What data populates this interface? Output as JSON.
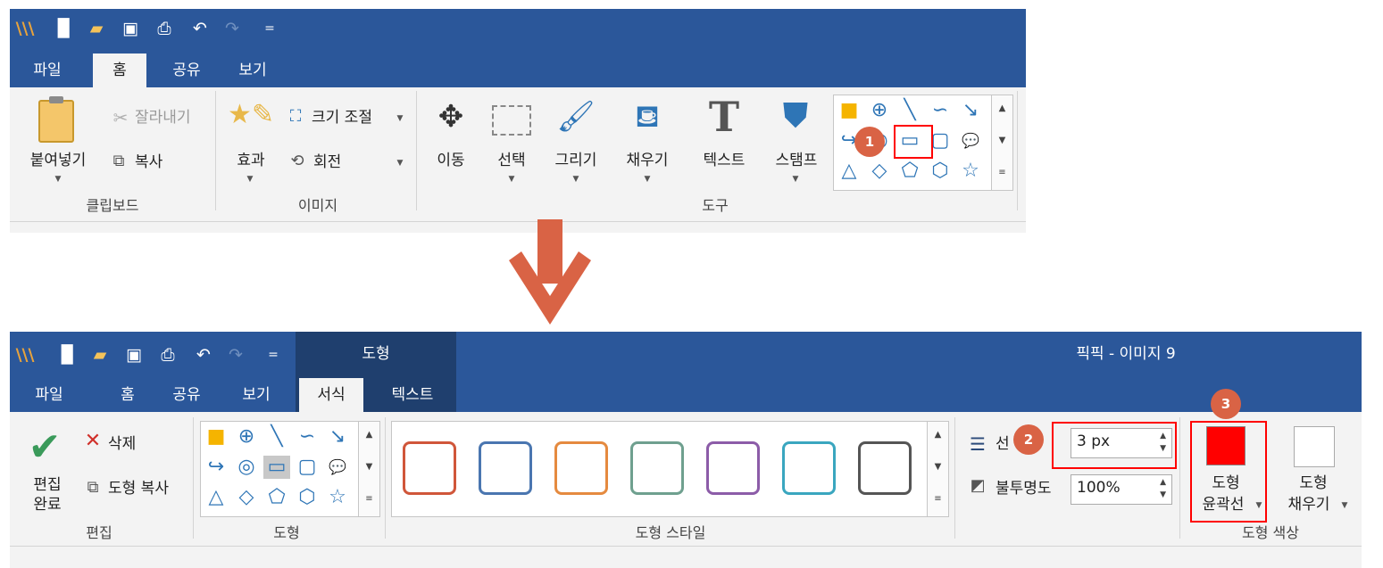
{
  "top": {
    "quick_access": {
      "icons": [
        "app-logo-icon",
        "new-file-icon",
        "open-folder-icon",
        "save-icon",
        "print-icon",
        "undo-icon",
        "redo-icon",
        "customize-icon"
      ],
      "customize_symbol": "="
    },
    "tabs": [
      "파일",
      "홈",
      "공유",
      "보기"
    ],
    "active_tab": "홈",
    "clipboard": {
      "paste": "붙여넣기",
      "cut": "잘라내기",
      "copy": "복사",
      "group": "클립보드"
    },
    "image": {
      "effect": "효과",
      "resize": "크기 조절",
      "rotate": "회전",
      "group": "이미지"
    },
    "tools": {
      "move": "이동",
      "select": "선택",
      "draw": "그리기",
      "fill": "채우기",
      "text": "텍스트",
      "stamp": "스탬프",
      "group": "도구"
    },
    "shape_gallery": [
      "■",
      "⊕",
      "╲",
      "∽",
      "↘",
      "↪",
      "◎",
      "▭",
      "▢",
      "💬",
      "△",
      "◇",
      "⬠",
      "⬡",
      "☆"
    ],
    "badge": "1"
  },
  "bottom": {
    "context_tab": "도형",
    "window_title": "픽픽 - 이미지 9",
    "tabs": [
      "파일",
      "홈",
      "공유",
      "보기",
      "서식",
      "텍스트"
    ],
    "active_tab": "서식",
    "edit": {
      "done_line1": "편집",
      "done_line2": "완료",
      "delete": "삭제",
      "copy_shape": "도형 복사",
      "group": "편집"
    },
    "shapes_group": "도형",
    "shape_styles_group": "도형 스타일",
    "style_colors": [
      "#d0563a",
      "#4a76b0",
      "#e58a3f",
      "#6fa08f",
      "#8c5ca8",
      "#3aa6bf",
      "#555555"
    ],
    "line_thickness": {
      "label_visible": "선",
      "value": "3 px"
    },
    "opacity": {
      "label": "불투명도",
      "value": "100%"
    },
    "shape_color": {
      "outline_line1": "도형",
      "outline_line2": "윤곽선",
      "fill_line1": "도형",
      "fill_line2": "채우기",
      "group": "도형 색상",
      "outline_color": "#ff0000",
      "fill_color": "#ffffff"
    },
    "badges": [
      "2",
      "3"
    ]
  },
  "colors": {
    "titlebar": "#2b579a",
    "ribbon_bg": "#f3f3f3",
    "arrow": "#d96345",
    "highlight": "#ff0000",
    "shape_blue": "#2e75b6"
  }
}
